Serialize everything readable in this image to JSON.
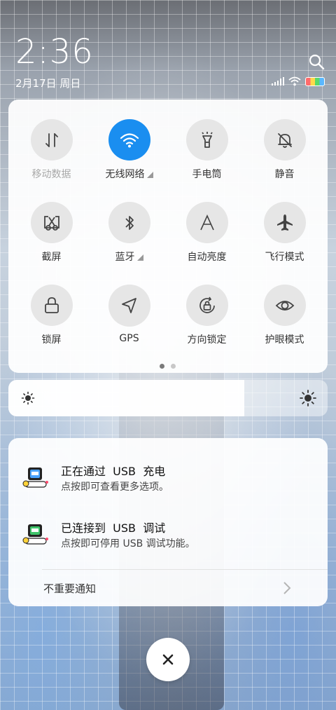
{
  "status": {
    "time": "2:36",
    "date": "2月17日 周日",
    "icons": [
      "signal-icon",
      "wifi-icon",
      "battery-icon"
    ]
  },
  "quick_settings": {
    "tiles": [
      {
        "label": "移动数据",
        "icon": "mobile-data-icon",
        "active": false,
        "disabled": true,
        "expandable": false
      },
      {
        "label": "无线网络",
        "icon": "wifi-icon",
        "active": true,
        "disabled": false,
        "expandable": true
      },
      {
        "label": "手电筒",
        "icon": "flashlight-icon",
        "active": false,
        "disabled": false,
        "expandable": false
      },
      {
        "label": "静音",
        "icon": "mute-bell-icon",
        "active": false,
        "disabled": false,
        "expandable": false
      },
      {
        "label": "截屏",
        "icon": "screenshot-icon",
        "active": false,
        "disabled": false,
        "expandable": false
      },
      {
        "label": "蓝牙",
        "icon": "bluetooth-icon",
        "active": false,
        "disabled": false,
        "expandable": true
      },
      {
        "label": "自动亮度",
        "icon": "auto-brightness-icon",
        "active": false,
        "disabled": false,
        "expandable": false
      },
      {
        "label": "飞行模式",
        "icon": "airplane-icon",
        "active": false,
        "disabled": false,
        "expandable": false
      },
      {
        "label": "锁屏",
        "icon": "lock-icon",
        "active": false,
        "disabled": false,
        "expandable": false
      },
      {
        "label": "GPS",
        "icon": "location-arrow-icon",
        "active": false,
        "disabled": false,
        "expandable": false
      },
      {
        "label": "方向锁定",
        "icon": "rotation-lock-icon",
        "active": false,
        "disabled": false,
        "expandable": false
      },
      {
        "label": "护眼模式",
        "icon": "eye-icon",
        "active": false,
        "disabled": false,
        "expandable": false
      }
    ],
    "page_count": 2,
    "current_page": 1,
    "accent_color": "#1a8ef0"
  },
  "brightness": {
    "level": 0.74
  },
  "notifications": [
    {
      "title": "正在通过  USB  充电",
      "text": "点按即可查看更多选项。",
      "icon": "usb-app-icon"
    },
    {
      "title": "已连接到  USB  调试",
      "text": "点按即可停用 USB 调试功能。",
      "icon": "usb-debug-app-icon"
    }
  ],
  "unimportant_label": "不重要通知"
}
